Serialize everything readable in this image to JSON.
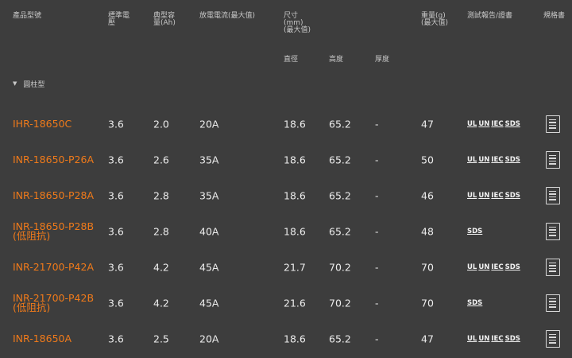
{
  "header": {
    "model": "產品型號",
    "voltage_l1": "標準電",
    "voltage_l2": "壓",
    "capacity_l1": "典型容",
    "capacity_l2": "量(Ah)",
    "discharge": "放電電流(最大值)",
    "size_l1": "尺寸",
    "size_l2": "(mm)",
    "size_l3": "(最大值)",
    "weight_l1": "重量(g)",
    "weight_l2": "(最大值)",
    "report": "測試報告/證書",
    "spec": "規格書",
    "diameter": "直徑",
    "height": "高度",
    "thickness": "厚度"
  },
  "group": {
    "label": "圓柱型",
    "icon": "triangle-down-icon"
  },
  "rows": [
    {
      "model": "IHR-18650C",
      "model2": "",
      "voltage": "3.6",
      "capacity": "2.0",
      "current": "20A",
      "diameter": "18.6",
      "height": "65.2",
      "thickness": "-",
      "weight": "47",
      "certs": [
        "UL",
        "UN",
        "IEC",
        "SDS"
      ]
    },
    {
      "model": "INR-18650-P26A",
      "model2": "",
      "voltage": "3.6",
      "capacity": "2.6",
      "current": "35A",
      "diameter": "18.6",
      "height": "65.2",
      "thickness": "-",
      "weight": "50",
      "certs": [
        "UL",
        "UN",
        "IEC",
        "SDS"
      ]
    },
    {
      "model": "INR-18650-P28A",
      "model2": "",
      "voltage": "3.6",
      "capacity": "2.8",
      "current": "35A",
      "diameter": "18.6",
      "height": "65.2",
      "thickness": "-",
      "weight": "46",
      "certs": [
        "UL",
        "UN",
        "IEC",
        "SDS"
      ]
    },
    {
      "model": "INR-18650-P28B",
      "model2": "(低阻抗)",
      "voltage": "3.6",
      "capacity": "2.8",
      "current": "40A",
      "diameter": "18.6",
      "height": "65.2",
      "thickness": "-",
      "weight": "48",
      "certs": [
        "SDS"
      ]
    },
    {
      "model": "INR-21700-P42A",
      "model2": "",
      "voltage": "3.6",
      "capacity": "4.2",
      "current": "45A",
      "diameter": "21.7",
      "height": "70.2",
      "thickness": "-",
      "weight": "70",
      "certs": [
        "UL",
        "UN",
        "IEC",
        "SDS"
      ]
    },
    {
      "model": "INR-21700-P42B",
      "model2": "(低阻抗)",
      "voltage": "3.6",
      "capacity": "4.2",
      "current": "45A",
      "diameter": "21.6",
      "height": "70.2",
      "thickness": "-",
      "weight": "70",
      "certs": [
        "SDS"
      ]
    },
    {
      "model": "INR-18650A",
      "model2": "",
      "voltage": "3.6",
      "capacity": "2.5",
      "current": "20A",
      "diameter": "18.6",
      "height": "65.2",
      "thickness": "-",
      "weight": "47",
      "certs": [
        "UL",
        "UN",
        "IEC",
        "SDS"
      ]
    }
  ],
  "icons": {
    "spec": "document-icon"
  },
  "colors": {
    "background": "#3d3d3d",
    "model_link": "#f07a1a",
    "text": "#ececec"
  }
}
